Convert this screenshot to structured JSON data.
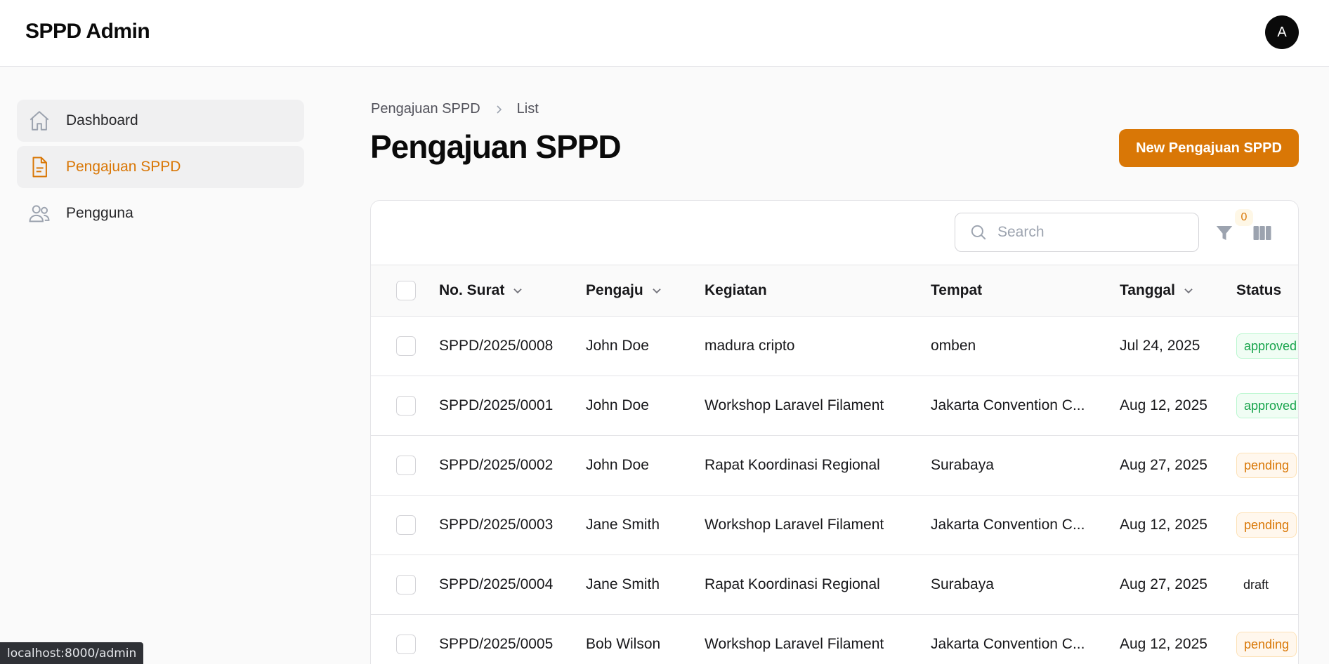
{
  "app": {
    "title": "SPPD Admin",
    "avatar_initial": "A"
  },
  "sidebar": {
    "items": [
      {
        "label": "Dashboard",
        "icon": "home-icon"
      },
      {
        "label": "Pengajuan SPPD",
        "icon": "document-icon",
        "active": true
      },
      {
        "label": "Pengguna",
        "icon": "users-icon"
      }
    ]
  },
  "breadcrumb": {
    "parent": "Pengajuan SPPD",
    "current": "List"
  },
  "page": {
    "title": "Pengajuan SPPD",
    "new_button": "New Pengajuan SPPD"
  },
  "toolbar": {
    "search_placeholder": "Search",
    "filter_count": "0"
  },
  "table": {
    "columns": [
      "No. Surat",
      "Pengaju",
      "Kegiatan",
      "Tempat",
      "Tanggal",
      "Status"
    ],
    "rows": [
      {
        "no_surat": "SPPD/2025/0008",
        "pengaju": "John Doe",
        "kegiatan": "madura cripto",
        "tempat": "omben",
        "tanggal": "Jul 24, 2025",
        "status": "approved"
      },
      {
        "no_surat": "SPPD/2025/0001",
        "pengaju": "John Doe",
        "kegiatan": "Workshop Laravel Filament",
        "tempat": "Jakarta Convention C...",
        "tanggal": "Aug 12, 2025",
        "status": "approved"
      },
      {
        "no_surat": "SPPD/2025/0002",
        "pengaju": "John Doe",
        "kegiatan": "Rapat Koordinasi Regional",
        "tempat": "Surabaya",
        "tanggal": "Aug 27, 2025",
        "status": "pending"
      },
      {
        "no_surat": "SPPD/2025/0003",
        "pengaju": "Jane Smith",
        "kegiatan": "Workshop Laravel Filament",
        "tempat": "Jakarta Convention C...",
        "tanggal": "Aug 12, 2025",
        "status": "pending"
      },
      {
        "no_surat": "SPPD/2025/0004",
        "pengaju": "Jane Smith",
        "kegiatan": "Rapat Koordinasi Regional",
        "tempat": "Surabaya",
        "tanggal": "Aug 27, 2025",
        "status": "draft"
      },
      {
        "no_surat": "SPPD/2025/0005",
        "pengaju": "Bob Wilson",
        "kegiatan": "Workshop Laravel Filament",
        "tempat": "Jakarta Convention C...",
        "tanggal": "Aug 12, 2025",
        "status": "pending"
      }
    ]
  },
  "statusbar": {
    "url": "localhost:8000/admin"
  },
  "colors": {
    "accent": "#d97706",
    "approved": "#16a34a",
    "pending": "#d97706"
  }
}
